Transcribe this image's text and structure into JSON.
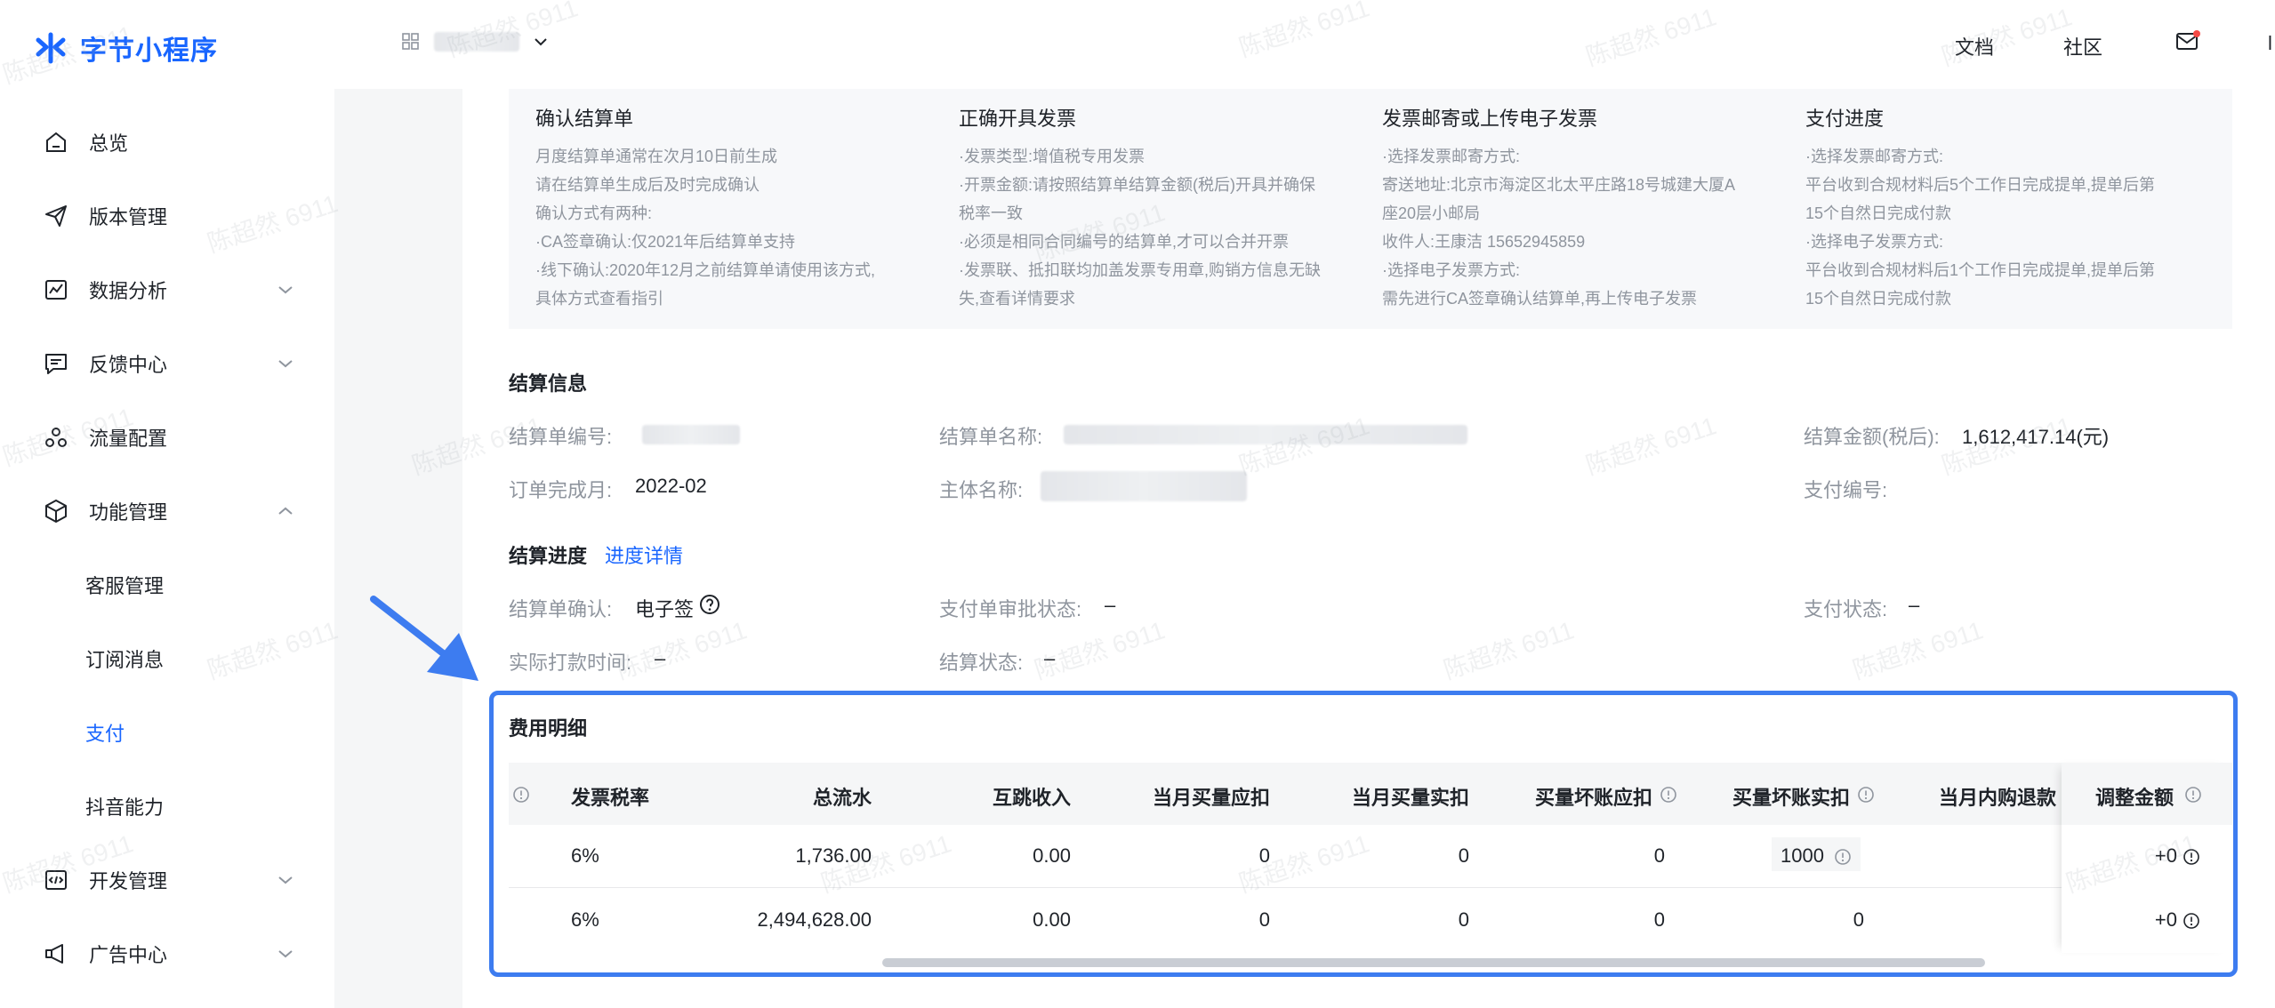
{
  "app": {
    "name": "字节小程序"
  },
  "topnav": {
    "docs": "文档",
    "community": "社区",
    "user_initial": "l"
  },
  "sidebar": {
    "items": [
      {
        "label": "总览"
      },
      {
        "label": "版本管理"
      },
      {
        "label": "数据分析"
      },
      {
        "label": "反馈中心"
      },
      {
        "label": "流量配置"
      },
      {
        "label": "功能管理"
      },
      {
        "label": "客服管理"
      },
      {
        "label": "订阅消息"
      },
      {
        "label": "支付"
      },
      {
        "label": "抖音能力"
      },
      {
        "label": "开发管理"
      },
      {
        "label": "广告中心"
      }
    ]
  },
  "steps": [
    {
      "title": "确认结算单",
      "lines": [
        "月度结算单通常在次月10日前生成",
        "请在结算单生成后及时完成确认",
        "确认方式有两种:",
        "·CA签章确认:仅2021年后结算单支持",
        "·线下确认:2020年12月之前结算单请使用该方式,",
        "具体方式查看指引"
      ]
    },
    {
      "title": "正确开具发票",
      "lines": [
        "·发票类型:增值税专用发票",
        "·开票金额:请按照结算单结算金额(税后)开具并确保",
        "税率一致",
        "·必须是相同合同编号的结算单,才可以合并开票",
        "·发票联、抵扣联均加盖发票专用章,购销方信息无缺",
        "失,查看详情要求"
      ]
    },
    {
      "title": "发票邮寄或上传电子发票",
      "lines": [
        "·选择发票邮寄方式:",
        "寄送地址:北京市海淀区北太平庄路18号城建大厦A",
        "座20层小邮局",
        "收件人:王康洁 15652945859",
        "·选择电子发票方式:",
        "需先进行CA签章确认结算单,再上传电子发票"
      ]
    },
    {
      "title": "支付进度",
      "lines": [
        "·选择发票邮寄方式:",
        "平台收到合规材料后5个工作日完成提单,提单后第",
        "15个自然日完成付款",
        "·选择电子发票方式:",
        "平台收到合规材料后1个工作日完成提单,提单后第",
        "15个自然日完成付款"
      ]
    }
  ],
  "settlement_info": {
    "title": "结算信息",
    "number_label": "结算单编号:",
    "name_label": "结算单名称:",
    "amount_label": "结算金额(税后):",
    "amount_value": "1,612,417.14(元)",
    "month_label": "订单完成月:",
    "month_value": "2022-02",
    "subject_label": "主体名称:",
    "payment_no_label": "支付编号:"
  },
  "progress": {
    "title": "结算进度",
    "detail_link": "进度详情",
    "confirm_label": "结算单确认:",
    "confirm_value": "电子签",
    "approval_label": "支付单审批状态:",
    "approval_value": "–",
    "pay_status_label": "支付状态:",
    "pay_status_value": "–",
    "paid_time_label": "实际打款时间:",
    "paid_time_value": "–",
    "settle_status_label": "结算状态:",
    "settle_status_value": "–"
  },
  "fees": {
    "title": "费用明细",
    "columns": [
      "发票税率",
      "总流水",
      "互跳收入",
      "当月买量应扣",
      "当月买量实扣",
      "买量坏账应扣",
      "买量坏账实扣",
      "当月内购退款",
      "调整金额"
    ],
    "rows": [
      [
        "6%",
        "1,736.00",
        "0.00",
        "0",
        "0",
        "0",
        "1000",
        "",
        "+0"
      ],
      [
        "6%",
        "2,494,628.00",
        "0.00",
        "0",
        "0",
        "0",
        "0",
        "",
        "+0"
      ]
    ]
  },
  "watermark": "陈超然 6911",
  "colors": {
    "accent": "#1966ff",
    "highlight": "#3d7cf0",
    "arrow": "#3d7cf0"
  }
}
